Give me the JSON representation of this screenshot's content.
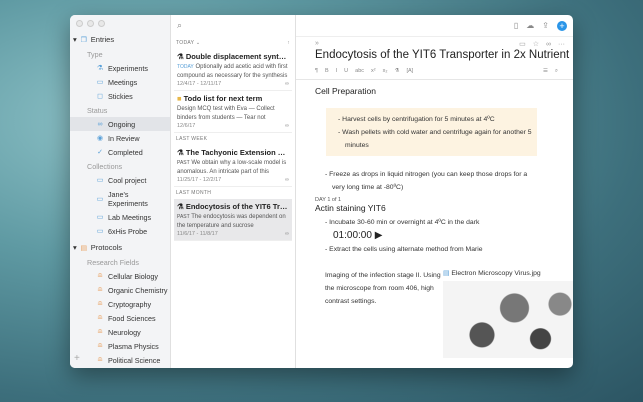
{
  "sidebar": {
    "entries": "Entries",
    "type": "Type",
    "types": [
      "Experiments",
      "Meetings",
      "Stickies"
    ],
    "status": "Status",
    "statuses": [
      "Ongoing",
      "In Review",
      "Completed"
    ],
    "collections": "Collections",
    "collection_items": [
      "Cool project",
      "Jane's Experiments",
      "Lab Meetings",
      "6xHis Probe"
    ],
    "protocols": "Protocols",
    "research_fields": "Research Fields",
    "fields": [
      "Cellular Biology",
      "Organic Chemistry",
      "Cryptography",
      "Food Sciences",
      "Neurology",
      "Plasma Physics",
      "Political Science"
    ],
    "add": "+"
  },
  "list": {
    "today": "TODAY ⌄",
    "sort": "↑",
    "last_week": "LAST WEEK",
    "last_month": "LAST MONTH",
    "cards": [
      {
        "title": "Double displacement synthesi...",
        "tag": "TODAY",
        "body": "Optionally add acetic acid with first compound as necessary for the synthesis",
        "date": "12/4/17 - 12/11/17"
      },
      {
        "title": "Todo list for next term",
        "tag": "",
        "body": "Design MCQ test with Eva — Collect binders from students — Tear not quarte...",
        "date": "12/6/17"
      },
      {
        "title": "The Tachyonic Extension of To...",
        "tag": "PAST",
        "body": "We obtain why a low-scale model is anomalous. An intricate part of this analy...",
        "date": "11/25/17 - 12/2/17"
      },
      {
        "title": "Endocytosis of the YIT6 Trans...",
        "tag": "PAST",
        "body": "The endocytosis was dependent on the temperature and sucrose concentrati...",
        "date": "11/6/17 - 11/8/17"
      }
    ]
  },
  "editor": {
    "title": "Endocytosis of the YIT6 Transporter in 2x Nutrient",
    "format": [
      "¶",
      "B",
      "I",
      "U",
      "abc",
      "x²",
      "x₂",
      "⚗",
      "[A]"
    ],
    "section1": "Cell Preparation",
    "note": [
      "Harvest cells by centrifugation for 5 minutes at 4ºC",
      "Wash pellets with cold water and centrifuge again for another 5 minutes"
    ],
    "bullet1": "Freeze as drops in liquid nitrogen (you can keep those drops for a very long time at -80ºC)",
    "day": "DAY 1 of 1",
    "section2": "Actin staining YIT6",
    "bullet2": "Incubate 30-60 min or overnight at 4ºC in the dark",
    "timer": "01:00:00 ▶",
    "bullet3": "Extract the cells using alternate method from Marie",
    "caption": "Imaging of the infection stage II. Using the microscope from room 406, high contrast settings.",
    "attachment": "Electron Microscopy Virus.jpg"
  }
}
